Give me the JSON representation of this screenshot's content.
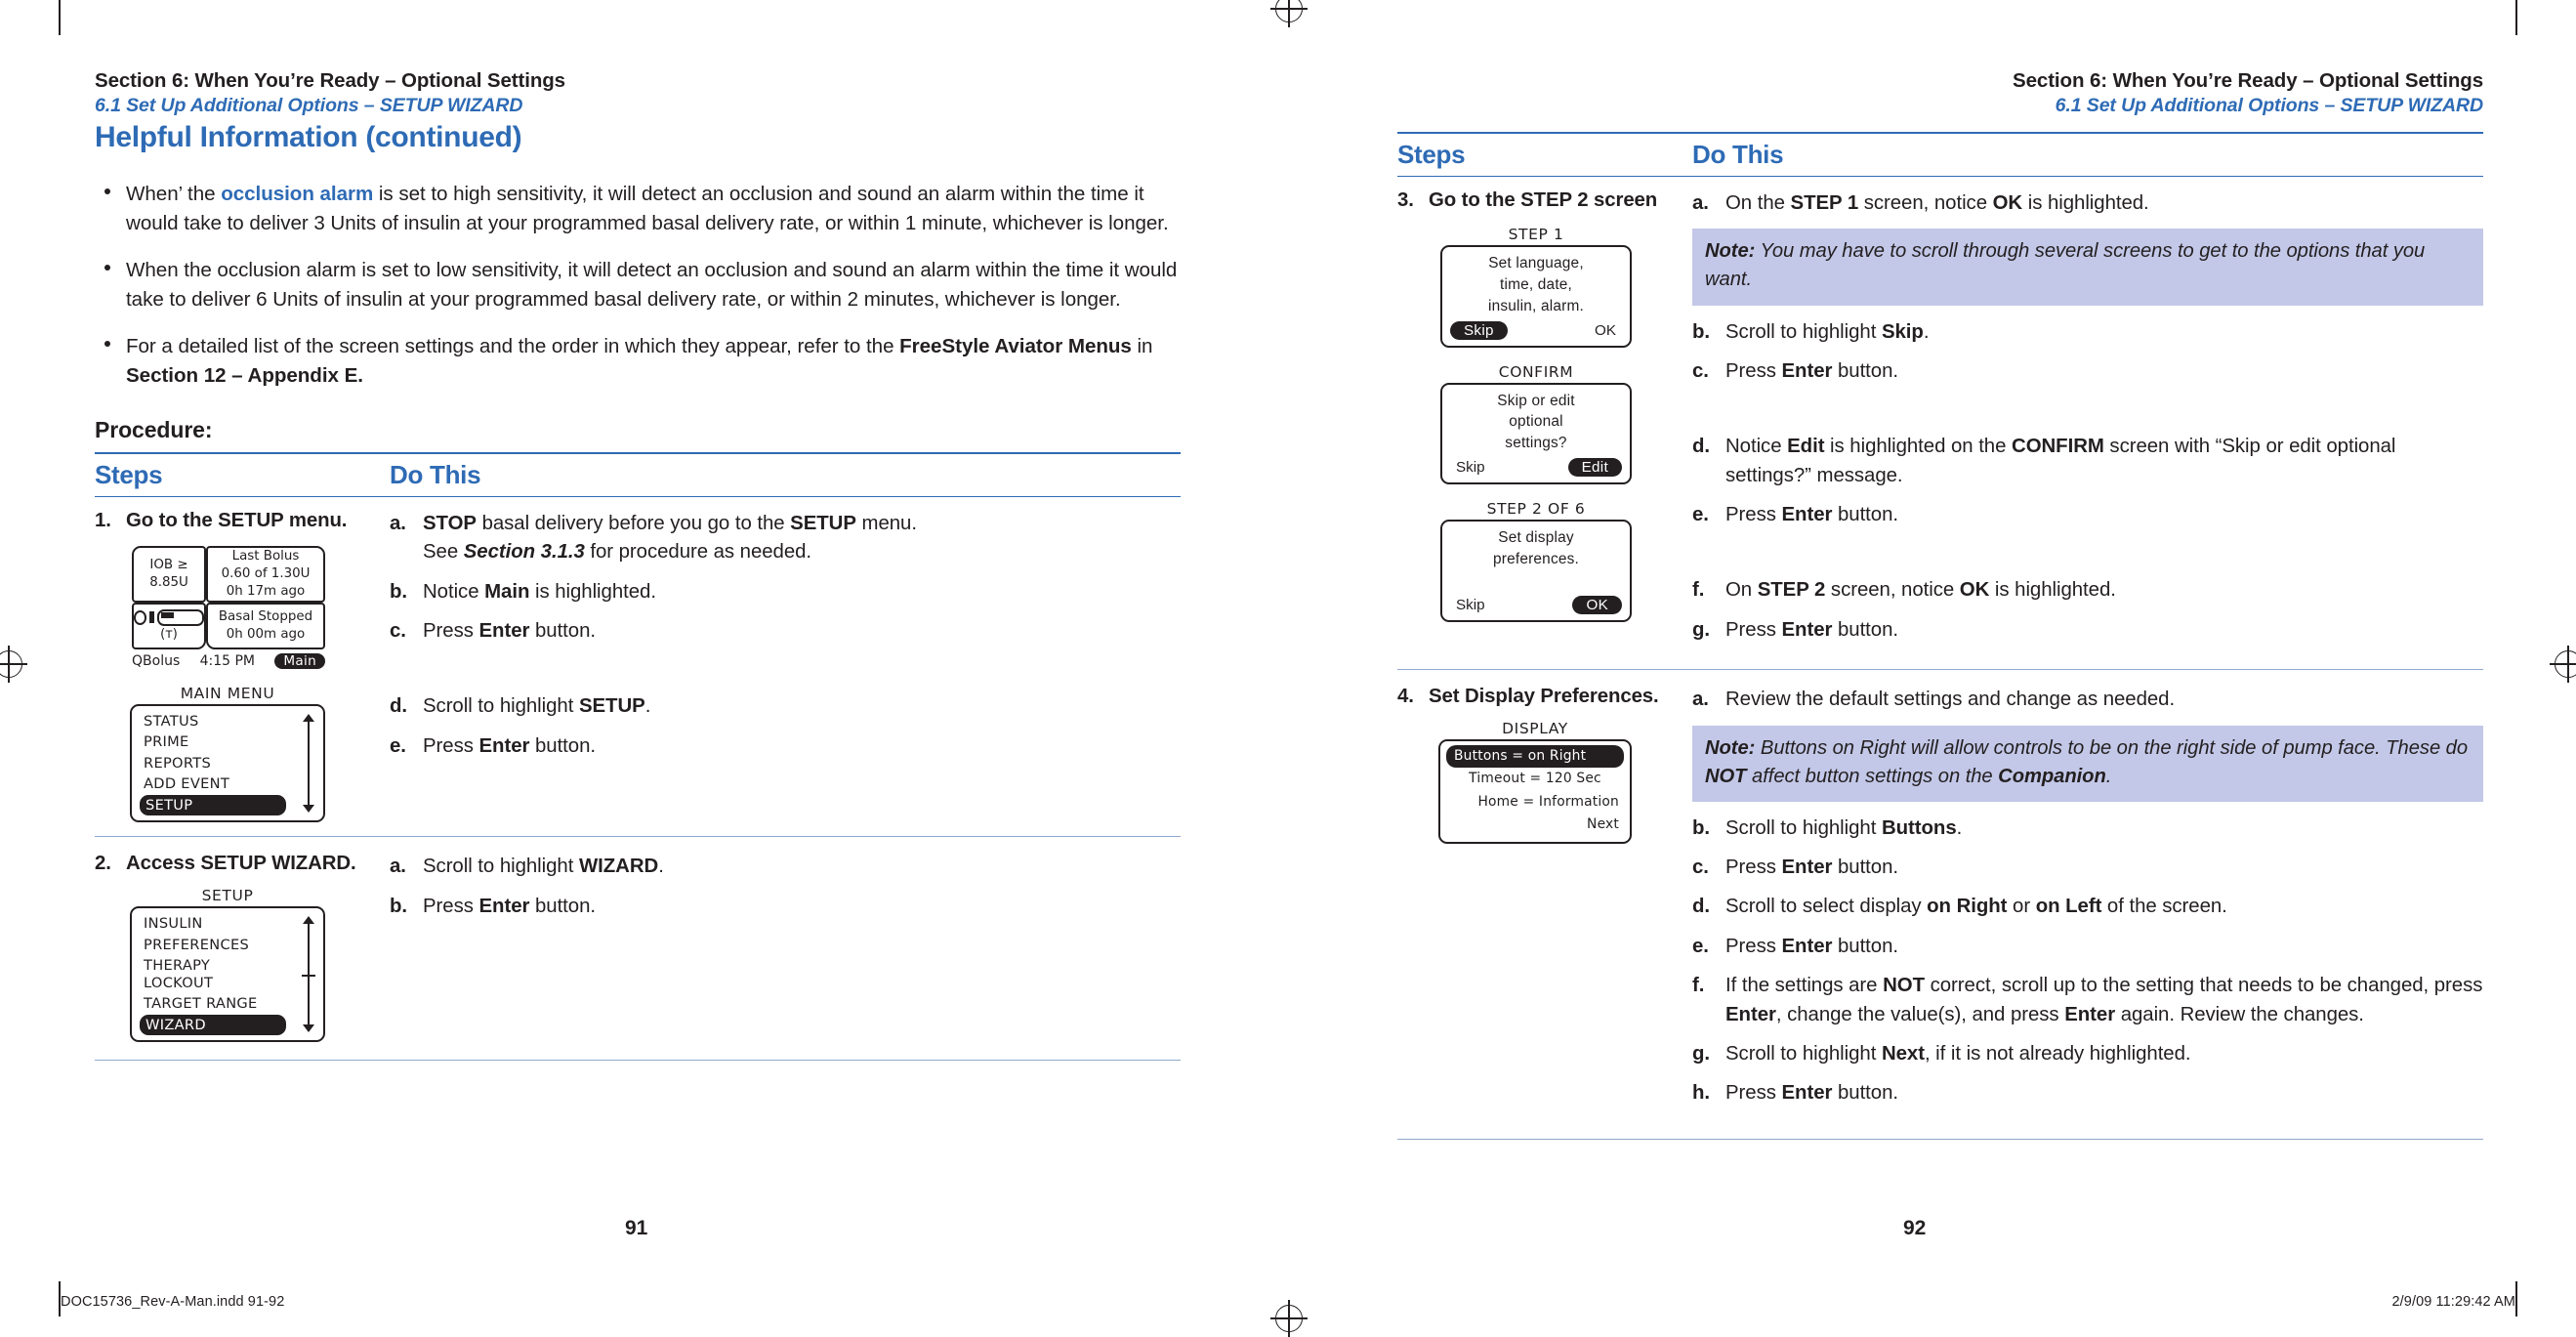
{
  "left_page": {
    "header_line1": "Section 6: When You’re Ready – Optional Settings",
    "header_line2": "6.1 Set Up Additional Options – SETUP WIZARD",
    "title": "Helpful Information (continued)",
    "bullets": [
      {
        "parts": [
          {
            "t": "When’ the ",
            "s": "plain"
          },
          {
            "t": "occlusion alarm",
            "s": "blue-bold"
          },
          {
            "t": " is set to high sensitivity, it will detect an occlusion and sound an alarm within the time it would take to deliver 3 Units of insulin at your programmed basal delivery rate, or within 1 minute, whichever is longer.",
            "s": "plain"
          }
        ]
      },
      {
        "parts": [
          {
            "t": "When the occlusion alarm is set to low sensitivity, it will detect an occlusion and sound an alarm within the time it would take to deliver 6 Units of insulin at your programmed basal delivery rate, or within 2 minutes, whichever is longer.",
            "s": "plain"
          }
        ]
      },
      {
        "parts": [
          {
            "t": "For a detailed list of the screen settings and the order in which they appear, refer to the ",
            "s": "plain"
          },
          {
            "t": "FreeStyle Aviator Menus",
            "s": "bold"
          },
          {
            "t": " in ",
            "s": "plain"
          },
          {
            "t": "Section 12 – Appendix E.",
            "s": "bold"
          }
        ]
      }
    ],
    "procedure_label": "Procedure:",
    "table_headers": {
      "steps": "Steps",
      "do_this": "Do This"
    },
    "rows": [
      {
        "number": "1.",
        "title": "Go to the SETUP menu.",
        "substeps": [
          {
            "label": "a.",
            "parts": [
              {
                "t": "STOP",
                "s": "bold"
              },
              {
                "t": " basal delivery before you go to the ",
                "s": "plain"
              },
              {
                "t": "SETUP",
                "s": "bold"
              },
              {
                "t": " menu.",
                "s": "plain"
              },
              {
                "t": "\nSee ",
                "s": "plain"
              },
              {
                "t": "Section 3.1.3",
                "s": "bold-italic"
              },
              {
                "t": " for procedure as needed.",
                "s": "plain"
              }
            ]
          },
          {
            "label": "b.",
            "parts": [
              {
                "t": "Notice ",
                "s": "plain"
              },
              {
                "t": "Main",
                "s": "bold"
              },
              {
                "t": " is highlighted.",
                "s": "plain"
              }
            ]
          },
          {
            "label": "c.",
            "parts": [
              {
                "t": "Press ",
                "s": "plain"
              },
              {
                "t": "Enter",
                "s": "bold"
              },
              {
                "t": " button.",
                "s": "plain"
              }
            ]
          },
          {
            "label": "d.",
            "gap": "lg",
            "parts": [
              {
                "t": "Scroll to highlight ",
                "s": "plain"
              },
              {
                "t": "SETUP",
                "s": "bold"
              },
              {
                "t": ".",
                "s": "plain"
              }
            ]
          },
          {
            "label": "e.",
            "parts": [
              {
                "t": "Press ",
                "s": "plain"
              },
              {
                "t": "Enter",
                "s": "bold"
              },
              {
                "t": " button.",
                "s": "plain"
              }
            ]
          }
        ]
      },
      {
        "number": "2.",
        "title": "Access SETUP WIZARD.",
        "substeps": [
          {
            "label": "a.",
            "parts": [
              {
                "t": "Scroll to highlight ",
                "s": "plain"
              },
              {
                "t": "WIZARD",
                "s": "bold"
              },
              {
                "t": ".",
                "s": "plain"
              }
            ]
          },
          {
            "label": "b.",
            "parts": [
              {
                "t": "Press ",
                "s": "plain"
              },
              {
                "t": "Enter",
                "s": "bold"
              },
              {
                "t": " button.",
                "s": "plain"
              }
            ]
          }
        ]
      }
    ],
    "folio": "91"
  },
  "right_page": {
    "header_line1": "Section 6: When You’re Ready – Optional Settings",
    "header_line2": "6.1 Set Up Additional Options – SETUP WIZARD",
    "table_headers": {
      "steps": "Steps",
      "do_this": "Do This"
    },
    "rows": [
      {
        "number": "3.",
        "title": "Go to the STEP 2 screen",
        "substeps": [
          {
            "label": "a.",
            "parts": [
              {
                "t": "On the ",
                "s": "plain"
              },
              {
                "t": "STEP 1",
                "s": "bold"
              },
              {
                "t": " screen, notice ",
                "s": "plain"
              },
              {
                "t": "OK",
                "s": "bold"
              },
              {
                "t": " is highlighted.",
                "s": "plain"
              }
            ]
          },
          {
            "note": {
              "prefix": "Note:",
              "text": " You may have to scroll through several screens to get to the options that you want."
            }
          },
          {
            "label": "b.",
            "parts": [
              {
                "t": "Scroll to highlight ",
                "s": "plain"
              },
              {
                "t": "Skip",
                "s": "bold"
              },
              {
                "t": ".",
                "s": "plain"
              }
            ]
          },
          {
            "label": "c.",
            "parts": [
              {
                "t": "Press ",
                "s": "plain"
              },
              {
                "t": "Enter",
                "s": "bold"
              },
              {
                "t": " button.",
                "s": "plain"
              }
            ]
          },
          {
            "label": "d.",
            "gap": "lg",
            "parts": [
              {
                "t": "Notice ",
                "s": "plain"
              },
              {
                "t": "Edit",
                "s": "bold"
              },
              {
                "t": " is highlighted on the ",
                "s": "plain"
              },
              {
                "t": "CONFIRM",
                "s": "bold"
              },
              {
                "t": " screen with “Skip or edit optional settings?” message.",
                "s": "plain"
              }
            ]
          },
          {
            "label": "e.",
            "parts": [
              {
                "t": "Press ",
                "s": "plain"
              },
              {
                "t": "Enter",
                "s": "bold"
              },
              {
                "t": " button.",
                "s": "plain"
              }
            ]
          },
          {
            "label": "f.",
            "gap": "lg",
            "parts": [
              {
                "t": "On ",
                "s": "plain"
              },
              {
                "t": "STEP 2",
                "s": "bold"
              },
              {
                "t": " screen, notice ",
                "s": "plain"
              },
              {
                "t": "OK",
                "s": "bold"
              },
              {
                "t": " is highlighted.",
                "s": "plain"
              }
            ]
          },
          {
            "label": "g.",
            "parts": [
              {
                "t": "Press ",
                "s": "plain"
              },
              {
                "t": "Enter",
                "s": "bold"
              },
              {
                "t": " button.",
                "s": "plain"
              }
            ]
          }
        ]
      },
      {
        "number": "4.",
        "title": "Set Display Preferences.",
        "substeps": [
          {
            "label": "a.",
            "parts": [
              {
                "t": "Review the default settings and change as needed.",
                "s": "plain"
              }
            ]
          },
          {
            "note": {
              "prefix": "Note:",
              "text": " Buttons on Right will allow controls to be on the right side of pump face. These do NOT affect button settings on the Companion."
            }
          },
          {
            "label": "b.",
            "parts": [
              {
                "t": "Scroll to highlight ",
                "s": "plain"
              },
              {
                "t": "Buttons",
                "s": "bold"
              },
              {
                "t": ".",
                "s": "plain"
              }
            ]
          },
          {
            "label": "c.",
            "parts": [
              {
                "t": "Press ",
                "s": "plain"
              },
              {
                "t": "Enter",
                "s": "bold"
              },
              {
                "t": " button.",
                "s": "plain"
              }
            ]
          },
          {
            "label": "d.",
            "parts": [
              {
                "t": "Scroll to select display ",
                "s": "plain"
              },
              {
                "t": "on Right",
                "s": "bold"
              },
              {
                "t": " or ",
                "s": "plain"
              },
              {
                "t": "on Left",
                "s": "bold"
              },
              {
                "t": " of the screen.",
                "s": "plain"
              }
            ]
          },
          {
            "label": "e.",
            "parts": [
              {
                "t": "Press ",
                "s": "plain"
              },
              {
                "t": "Enter",
                "s": "bold"
              },
              {
                "t": " button.",
                "s": "plain"
              }
            ]
          },
          {
            "label": "f.",
            "parts": [
              {
                "t": "If the settings are ",
                "s": "plain"
              },
              {
                "t": "NOT",
                "s": "bold"
              },
              {
                "t": " correct, scroll up to the setting that needs to be changed, press ",
                "s": "plain"
              },
              {
                "t": "Enter",
                "s": "bold"
              },
              {
                "t": ", change the value(s), and press ",
                "s": "plain"
              },
              {
                "t": "Enter",
                "s": "bold"
              },
              {
                "t": " again. Review the changes.",
                "s": "plain"
              }
            ]
          },
          {
            "label": "g.",
            "parts": [
              {
                "t": "Scroll to highlight ",
                "s": "plain"
              },
              {
                "t": "Next",
                "s": "bold"
              },
              {
                "t": ", if it is not already highlighted.",
                "s": "plain"
              }
            ]
          },
          {
            "label": "h.",
            "parts": [
              {
                "t": "Press ",
                "s": "plain"
              },
              {
                "t": "Enter",
                "s": "bold"
              },
              {
                "t": " button.",
                "s": "plain"
              }
            ]
          }
        ]
      }
    ],
    "folio": "92"
  },
  "screens": {
    "home": {
      "iob_label": "IOB ≥",
      "iob_value": "8.85U",
      "last_bolus_label": "Last Bolus",
      "last_bolus_value": "0.60 of 1.30U",
      "last_bolus_time": "0h 17m ago",
      "basal_label": "Basal Stopped",
      "basal_time": "0h 00m ago",
      "qbolus": "QBolus",
      "clock": "4:15 PM",
      "main_button": "Main"
    },
    "main_menu": {
      "caption": "MAIN MENU",
      "items": [
        "STATUS",
        "PRIME",
        "REPORTS",
        "ADD EVENT",
        "SETUP"
      ],
      "selected": "SETUP"
    },
    "setup_menu": {
      "caption": "SETUP",
      "items": [
        "INSULIN",
        "PREFERENCES",
        "THERAPY LOCKOUT",
        "TARGET RANGE",
        "WIZARD"
      ],
      "selected": "WIZARD"
    },
    "step1": {
      "caption": "STEP 1",
      "lines": [
        "Set language,",
        "time, date,",
        "insulin, alarm."
      ],
      "left_button": "Skip",
      "right_button": "OK",
      "selected": "Skip"
    },
    "confirm": {
      "caption": "CONFIRM",
      "lines": [
        "Skip or edit",
        "optional",
        "settings?"
      ],
      "left_button": "Skip",
      "right_button": "Edit",
      "selected": "Edit"
    },
    "step2": {
      "caption": "STEP 2 OF 6",
      "lines": [
        "Set display",
        "preferences."
      ],
      "left_button": "Skip",
      "right_button": "OK",
      "selected": "OK"
    },
    "display": {
      "caption": "DISPLAY",
      "rows": [
        {
          "text": "Buttons = on Right",
          "align": "left",
          "selected": true
        },
        {
          "text": "Timeout = 120  Sec",
          "align": "center",
          "selected": false
        },
        {
          "text": "Home = Information",
          "align": "right",
          "selected": false
        },
        {
          "text": "Next",
          "align": "right",
          "selected": false
        }
      ]
    }
  },
  "print_footer": {
    "left": "DOC15736_Rev-A-Man.indd   91-92",
    "right": "2/9/09   11:29:42 AM"
  },
  "colors": {
    "accent_blue": "#2e6bb5",
    "note_background": "#c3c8e8",
    "text": "#231f20"
  }
}
